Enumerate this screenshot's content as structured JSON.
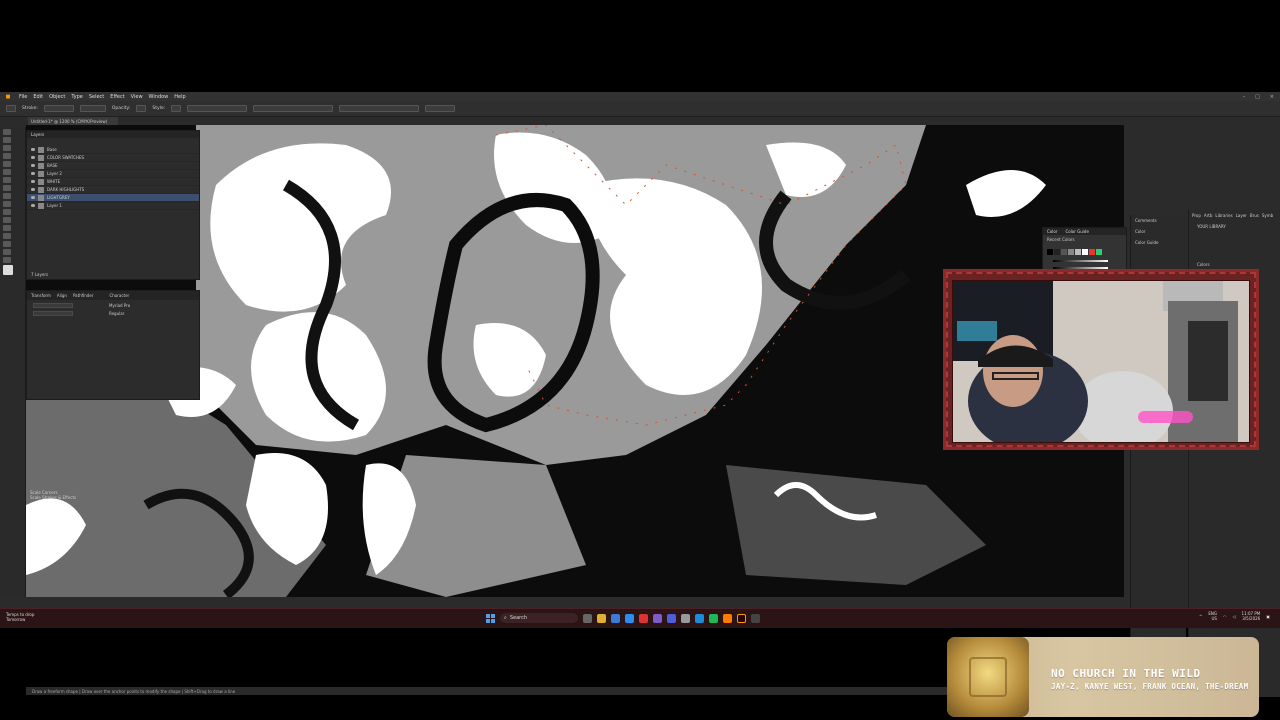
{
  "app": {
    "menu": [
      "File",
      "Edit",
      "Object",
      "Type",
      "Select",
      "Effect",
      "View",
      "Window",
      "Help"
    ],
    "doc_tab": "Untitled-1* @ 1200 % (CMYK/Preview)",
    "control_labels": [
      "Stroke:",
      "Opacity:",
      "Style:"
    ],
    "status_text": "Draw a freeform shape | Draw over the anchor points to modify the shape | Shift+Drag to draw a line"
  },
  "layers": {
    "tab": "Layers",
    "rows": [
      "Base",
      "COLOR SWATCHES",
      "BASE",
      "Layer 2",
      "WHITE",
      "DARK HIGHLIGHTS",
      "LIGHTGREY",
      "Layer 1"
    ],
    "selected_index": 6,
    "footer": "7 Layers"
  },
  "props": {
    "tabs": [
      "Transform",
      "Align",
      "Pathfinder"
    ],
    "char_tab": "Character",
    "font": "Myriad Pro",
    "style": "Regular",
    "checks": [
      "Scale Corners",
      "Scale Strokes & Effects"
    ]
  },
  "color_panel": {
    "tabs": [
      "Color",
      "Color Guide"
    ],
    "label": "Recent Colors"
  },
  "right_panels": {
    "col1": [
      "Comments",
      "Color",
      "Color Guide"
    ],
    "col2_tabs": [
      "Prop",
      "Artb",
      "Libraries",
      "Layer",
      "Brus",
      "Symb"
    ],
    "library": "YOUR LIBRARY",
    "colors_label": "Colors",
    "accent": "#2ecc71"
  },
  "taskbar": {
    "weather_line1": "Temps to drop",
    "weather_line2": "Tomorrow",
    "search": "Search",
    "lang1": "ENG",
    "lang2": "US",
    "time": "11:07 PM",
    "date": "3/5/2026"
  },
  "now_playing": {
    "song": "NO CHURCH IN THE WILD",
    "artists": "JAY-Z, KANYE WEST, FRANK OCEAN, THE-DREAM"
  }
}
